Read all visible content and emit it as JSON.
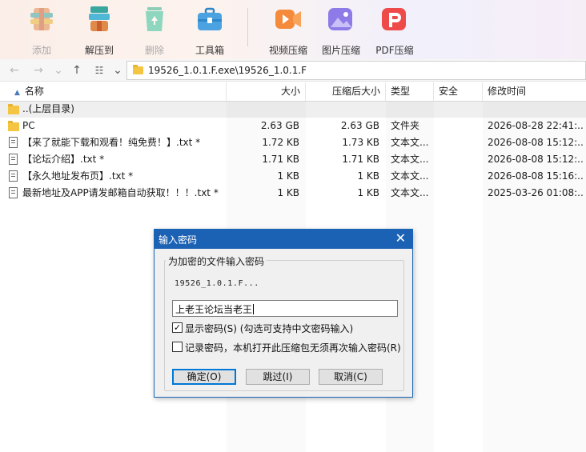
{
  "toolbar": {
    "buttons": [
      {
        "label": "添加",
        "icon": "add-archive-icon",
        "enabled": false
      },
      {
        "label": "解压到",
        "icon": "extract-to-icon",
        "enabled": true
      },
      {
        "label": "删除",
        "icon": "delete-recycle-icon",
        "enabled": false
      },
      {
        "label": "工具箱",
        "icon": "toolbox-icon",
        "enabled": true
      },
      {
        "label": "视频压缩",
        "icon": "video-compress-icon",
        "enabled": true
      },
      {
        "label": "图片压缩",
        "icon": "image-compress-icon",
        "enabled": true
      },
      {
        "label": "PDF压缩",
        "icon": "pdf-compress-icon",
        "enabled": true
      }
    ]
  },
  "address": {
    "path": "19526_1.0.1.F.exe\\19526_1.0.1.F"
  },
  "columns": {
    "name": "名称",
    "size": "大小",
    "packed": "压缩后大小",
    "type": "类型",
    "security": "安全",
    "modified": "修改时间"
  },
  "rows": [
    {
      "name": "..(上层目录)",
      "icon": "folder-icon",
      "size": "",
      "packed": "",
      "type": "",
      "security": "",
      "modified": ""
    },
    {
      "name": "PC",
      "icon": "folder-icon",
      "size": "2.63 GB",
      "packed": "2.63 GB",
      "type": "文件夹",
      "security": "",
      "modified": "2026-08-28 22:41:..."
    },
    {
      "name": "【来了就能下载和观看！纯免费！】.txt *",
      "icon": "text-file-icon",
      "size": "1.72 KB",
      "packed": "1.73 KB",
      "type": "文本文...",
      "security": "",
      "modified": "2026-08-08 15:12:..."
    },
    {
      "name": "【论坛介绍】.txt *",
      "icon": "text-file-icon",
      "size": "1.71 KB",
      "packed": "1.71 KB",
      "type": "文本文...",
      "security": "",
      "modified": "2026-08-08 15:12:..."
    },
    {
      "name": "【永久地址发布页】.txt *",
      "icon": "text-file-icon",
      "size": "1 KB",
      "packed": "1 KB",
      "type": "文本文...",
      "security": "",
      "modified": "2026-08-08 15:16:..."
    },
    {
      "name": "最新地址及APP请发邮箱自动获取！！！.txt *",
      "icon": "text-file-icon",
      "size": "1 KB",
      "packed": "1 KB",
      "type": "文本文...",
      "security": "",
      "modified": "2025-03-26 01:08:..."
    }
  ],
  "dialog": {
    "title": "输入密码",
    "group_label": "为加密的文件输入密码",
    "archive_name": "19526_1.0.1.F...",
    "password_value": "上老王论坛当老王",
    "show_password": {
      "label": "显示密码(S) (勾选可支持中文密码输入)",
      "checked": true,
      "mark": "✓"
    },
    "remember_password": {
      "label": "记录密码，本机打开此压缩包无须再次输入密码(R)",
      "checked": false,
      "mark": ""
    },
    "buttons": {
      "ok": "确定(O)",
      "skip": "跳过(I)",
      "cancel": "取消(C)"
    },
    "close_glyph": "✕"
  },
  "colors": {
    "dialog_title_bg": "#1c62b4",
    "selected_row_bg": "#e0e0e0",
    "default_button_border": "#0078d7"
  }
}
